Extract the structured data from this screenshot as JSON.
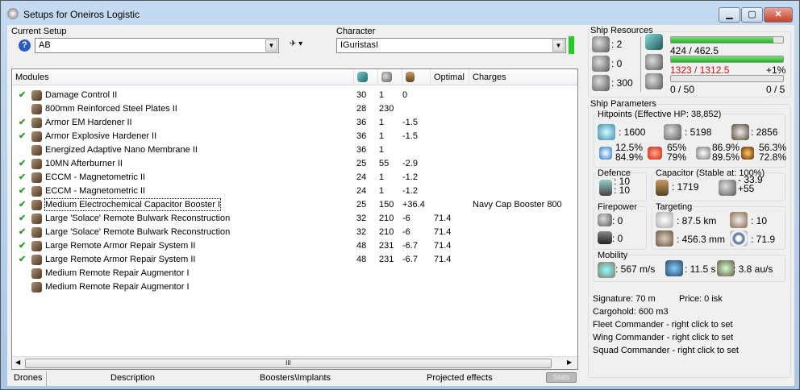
{
  "window": {
    "title": "Setups for Oneiros Logistic",
    "min": "▁",
    "max": "▢",
    "close": "✕"
  },
  "setup": {
    "label": "Current Setup",
    "value": "AB",
    "help": "?"
  },
  "character": {
    "label": "Character",
    "value": "IGuristasI",
    "status_color": "#22cc22"
  },
  "table": {
    "headers": [
      "Modules",
      "",
      "",
      "",
      "Optimal",
      "Charges"
    ],
    "rows": [
      {
        "checked": true,
        "name": "Damage Control II",
        "cpu": "30",
        "pg": "1",
        "cap": "0",
        "optimal": "",
        "charges": ""
      },
      {
        "checked": false,
        "name": "800mm Reinforced Steel Plates II",
        "cpu": "28",
        "pg": "230",
        "cap": "",
        "optimal": "",
        "charges": ""
      },
      {
        "checked": true,
        "name": "Armor EM Hardener II",
        "cpu": "36",
        "pg": "1",
        "cap": "-1.5",
        "optimal": "",
        "charges": ""
      },
      {
        "checked": true,
        "name": "Armor Explosive Hardener II",
        "cpu": "36",
        "pg": "1",
        "cap": "-1.5",
        "optimal": "",
        "charges": ""
      },
      {
        "checked": false,
        "name": "Energized Adaptive Nano Membrane II",
        "cpu": "36",
        "pg": "1",
        "cap": "",
        "optimal": "",
        "charges": ""
      },
      {
        "checked": true,
        "name": "10MN Afterburner II",
        "cpu": "25",
        "pg": "55",
        "cap": "-2.9",
        "optimal": "",
        "charges": ""
      },
      {
        "checked": true,
        "name": "ECCM - Magnetometric II",
        "cpu": "24",
        "pg": "1",
        "cap": "-1.2",
        "optimal": "",
        "charges": ""
      },
      {
        "checked": true,
        "name": "ECCM - Magnetometric II",
        "cpu": "24",
        "pg": "1",
        "cap": "-1.2",
        "optimal": "",
        "charges": ""
      },
      {
        "checked": true,
        "name": "Medium Electrochemical Capacitor Booster I",
        "cpu": "25",
        "pg": "150",
        "cap": "+36.4",
        "optimal": "",
        "charges": "Navy Cap Booster 800"
      },
      {
        "checked": true,
        "name": "Large 'Solace' Remote Bulwark Reconstruction",
        "cpu": "32",
        "pg": "210",
        "cap": "-6",
        "optimal": "71.4",
        "charges": ""
      },
      {
        "checked": true,
        "name": "Large 'Solace' Remote Bulwark Reconstruction",
        "cpu": "32",
        "pg": "210",
        "cap": "-6",
        "optimal": "71.4",
        "charges": ""
      },
      {
        "checked": true,
        "name": "Large Remote Armor Repair System II",
        "cpu": "48",
        "pg": "231",
        "cap": "-6.7",
        "optimal": "71.4",
        "charges": ""
      },
      {
        "checked": true,
        "name": "Large Remote Armor Repair System II",
        "cpu": "48",
        "pg": "231",
        "cap": "-6.7",
        "optimal": "71.4",
        "charges": ""
      },
      {
        "checked": false,
        "name": "Medium Remote Repair Augmentor I",
        "cpu": "",
        "pg": "",
        "cap": "",
        "optimal": "",
        "charges": ""
      },
      {
        "checked": false,
        "name": "Medium Remote Repair Augmentor I",
        "cpu": "",
        "pg": "",
        "cap": "",
        "optimal": "",
        "charges": ""
      }
    ],
    "scroll_grip": "III"
  },
  "tabs": [
    "Drones",
    "Description",
    "Boosters\\Implants",
    "Projected effects",
    "Stats"
  ],
  "resources": {
    "title": "Ship Resources",
    "turrets": ": 2",
    "launchers": ": 0",
    "calibration": ": 300",
    "cpu": "424 / 462.5",
    "cpu_fraction": 0.917,
    "pg": "1323 / 1312.5",
    "pg_over": "+1%",
    "pg_fraction": 1.0,
    "drone_bay": "0 / 50",
    "drones": "0 / 5",
    "drone_fraction": 0
  },
  "params": {
    "title": "Ship Parameters",
    "hp_title": "Hitpoints (Effective HP: 38,852)",
    "shield": ": 1600",
    "armor": ": 5198",
    "hull": ": 2856",
    "res": [
      [
        "12.5%",
        "84.9%"
      ],
      [
        "65%",
        "79%"
      ],
      [
        "86.9%",
        "89.5%"
      ],
      [
        "56.3%",
        "72.8%"
      ]
    ],
    "defence_title": "Defence",
    "def1": ": 10",
    "def2": ": 10",
    "cap_title": "Capacitor (Stable at: 100%)",
    "cap_amount": ": 1719",
    "cap_use": "- 33.9",
    "cap_regen": "+55",
    "fire_title": "Firepower",
    "fire1": ": 0",
    "fire2": ": 0",
    "target_title": "Targeting",
    "range": ": 87.5 km",
    "max_targets": ": 10",
    "sensor": ": 456.3 mm",
    "scan": ": 71.9",
    "mob_title": "Mobility",
    "speed": ": 567 m/s",
    "align": ": 11.5 s",
    "warp": ": 3.8 au/s",
    "signature": "Signature: 70 m",
    "price": "Price: 0 isk",
    "cargo": "Cargohold: 600 m3",
    "fleet": "Fleet Commander - right click to set",
    "wing": "Wing Commander - right click to set",
    "squad": "Squad Commander - right click to set"
  }
}
